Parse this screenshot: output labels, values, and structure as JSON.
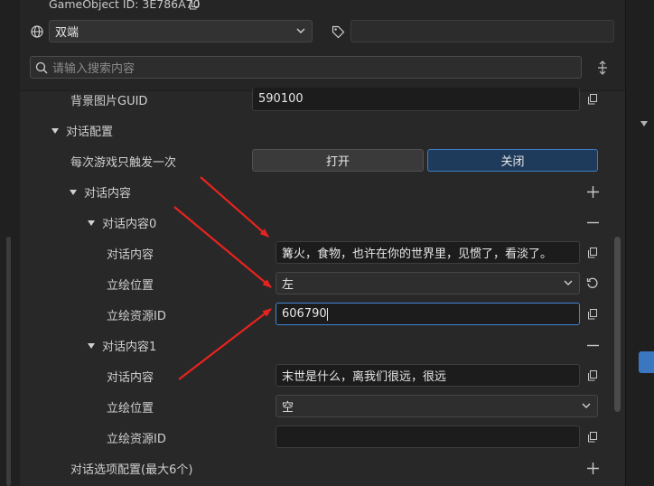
{
  "header": {
    "gameobject_id_label": "GameObject ID:",
    "gameobject_id_value": "3E786A70",
    "platform_selected": "双端",
    "tag_value": "",
    "search_placeholder": "请输入搜索内容"
  },
  "props": {
    "bg_guid_label": "背景图片GUID",
    "bg_guid_value": "590100",
    "dialog_config_label": "对话配置",
    "trigger_once_label": "每次游戏只触发一次",
    "toggle_on": "打开",
    "toggle_off": "关闭",
    "toggle_selected": "关闭",
    "dialog_list_label": "对话内容",
    "item0": {
      "label": "对话内容0",
      "content_label": "对话内容",
      "content_value": "篝火，食物，也许在你的世界里，见惯了，看淡了。",
      "pos_label": "立绘位置",
      "pos_value": "左",
      "res_label": "立绘资源ID",
      "res_value": "606790"
    },
    "item1": {
      "label": "对话内容1",
      "content_label": "对话内容",
      "content_value": "末世是什么，离我们很远，很远",
      "pos_label": "立绘位置",
      "pos_value": "空",
      "res_label": "立绘资源ID",
      "res_value": ""
    },
    "options_label": "对话选项配置(最大6个)"
  },
  "colors": {
    "accent": "#3c7cc4",
    "arrow": "#e8231f"
  },
  "icons": [
    "copy-icon",
    "globe-icon",
    "chevron-down-icon",
    "tag-icon",
    "search-icon",
    "drag-handle-icon",
    "plus-icon",
    "minus-icon",
    "reset-icon",
    "expand-triangle-icon"
  ]
}
